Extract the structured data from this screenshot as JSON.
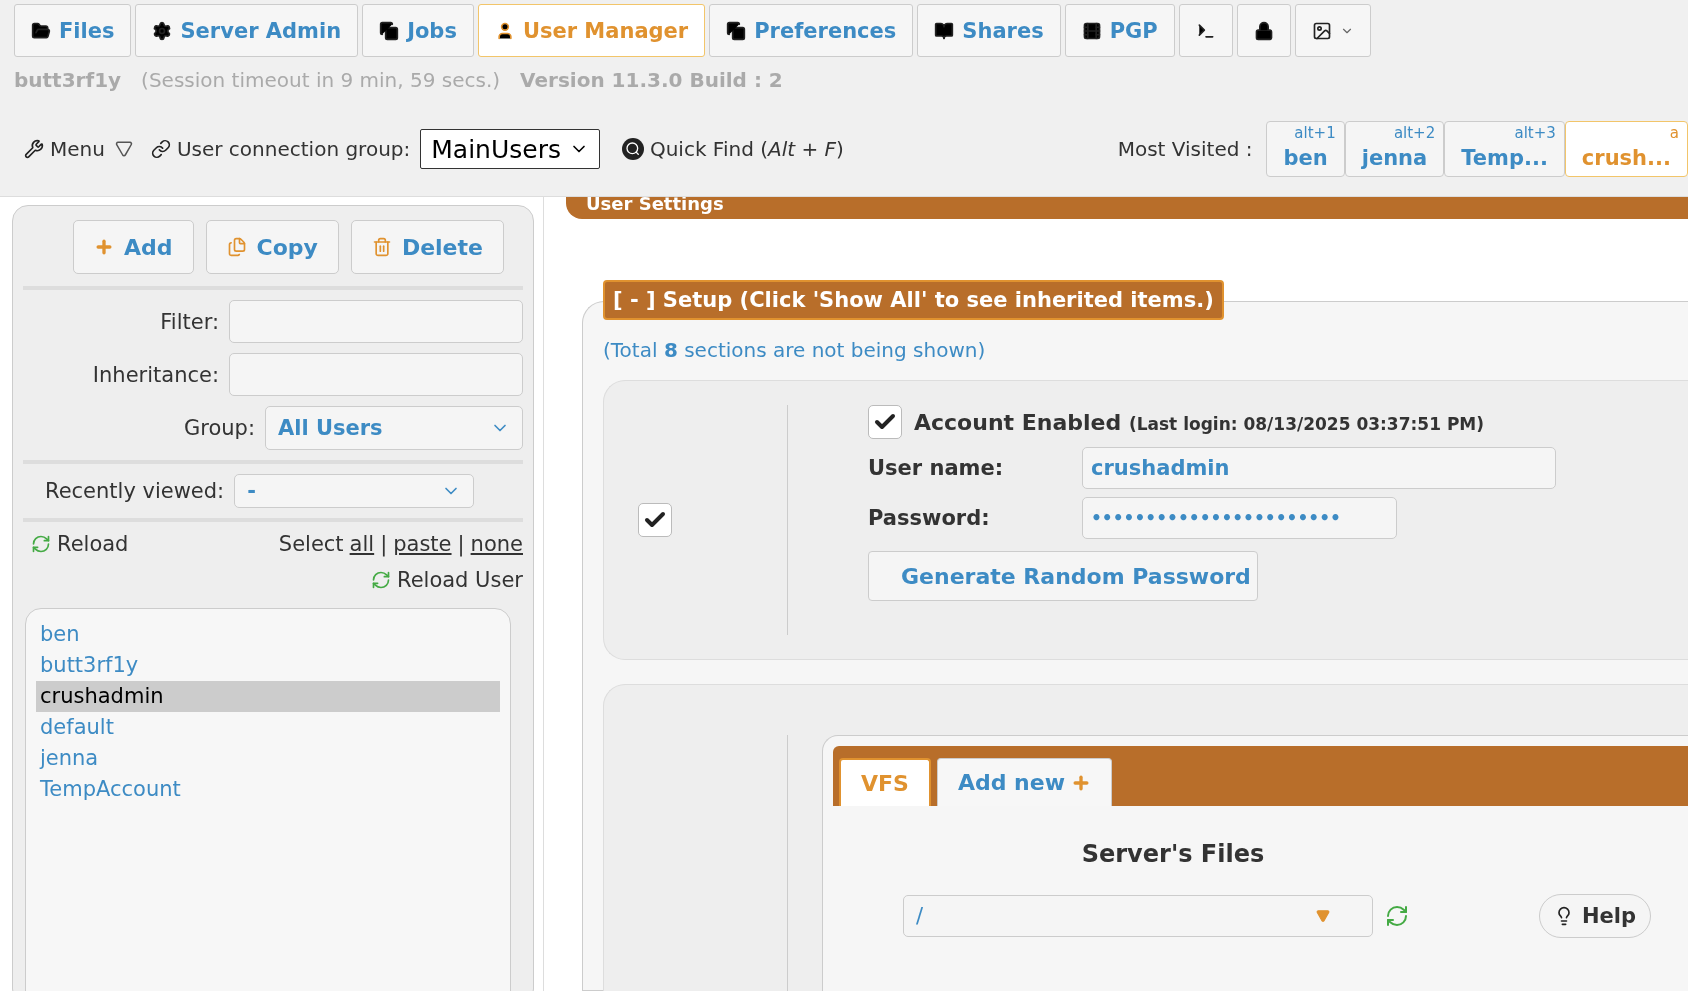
{
  "tabs": [
    {
      "label": "Files",
      "selected": false
    },
    {
      "label": "Server Admin",
      "selected": false
    },
    {
      "label": "Jobs",
      "selected": false
    },
    {
      "label": "User Manager",
      "selected": true
    },
    {
      "label": "Preferences",
      "selected": false
    },
    {
      "label": "Shares",
      "selected": false
    },
    {
      "label": "PGP",
      "selected": false
    },
    {
      "selected": false
    },
    {
      "selected": false
    },
    {
      "selected": false
    }
  ],
  "session": {
    "user": "butt3rf1y",
    "timeout": "(Session timeout in 9 min, 59 secs.)",
    "version": "Version 11.3.0 Build : 2"
  },
  "toolbar": {
    "menu": "Menu",
    "group_label": "User connection group:",
    "group_value": "MainUsers",
    "quick_find": "Quick Find (*Alt + F*)",
    "most_visited_label": "Most Visited :",
    "most_visited": [
      {
        "hint": "alt+1",
        "name": "ben",
        "selected": false
      },
      {
        "hint": "alt+2",
        "name": "jenna",
        "selected": false
      },
      {
        "hint": "alt+3",
        "name": "Temp...",
        "selected": false
      },
      {
        "hint": "a",
        "name": "crush...",
        "selected": true
      }
    ]
  },
  "sidebar": {
    "buttons": [
      "Add",
      "Copy",
      "Delete"
    ],
    "filter_label": "Filter:",
    "inheritance_label": "Inheritance:",
    "group_label": "Group:",
    "group_value": "All Users",
    "recent_label": "Recently viewed:",
    "recent_value": "-",
    "reload": "Reload",
    "select_label": "Select",
    "select_links": [
      "all",
      "paste",
      "none"
    ],
    "separator": "|",
    "reload_user": "Reload User",
    "users": [
      {
        "name": "ben",
        "selected": false
      },
      {
        "name": "butt3rf1y",
        "selected": false
      },
      {
        "name": "crushadmin",
        "selected": true
      },
      {
        "name": "default",
        "selected": false
      },
      {
        "name": "jenna",
        "selected": false
      },
      {
        "name": "TempAccount",
        "selected": false
      }
    ]
  },
  "settings": {
    "title": "User Settings",
    "setup_legend": "[ - ] Setup (Click 'Show All' to see inherited items.)",
    "note": "(Total **8** sections are not being shown)",
    "row_checked": true,
    "account_enabled": {
      "label": "Account Enabled",
      "checked": true,
      "last_login": "(Last login: 08/13/2025 03:37:51 PM)"
    },
    "username": {
      "label": "User name:",
      "value": "crushadmin"
    },
    "password": {
      "label": "Password:",
      "value": "•••••••••••••••••••••••"
    },
    "generate": "Generate Random Password",
    "vfs_tabs": [
      {
        "label": "VFS",
        "selected": true
      },
      {
        "label": "Add new",
        "selected": false
      }
    ],
    "files_title": "Server's Files",
    "path": "/",
    "help": "Help"
  }
}
